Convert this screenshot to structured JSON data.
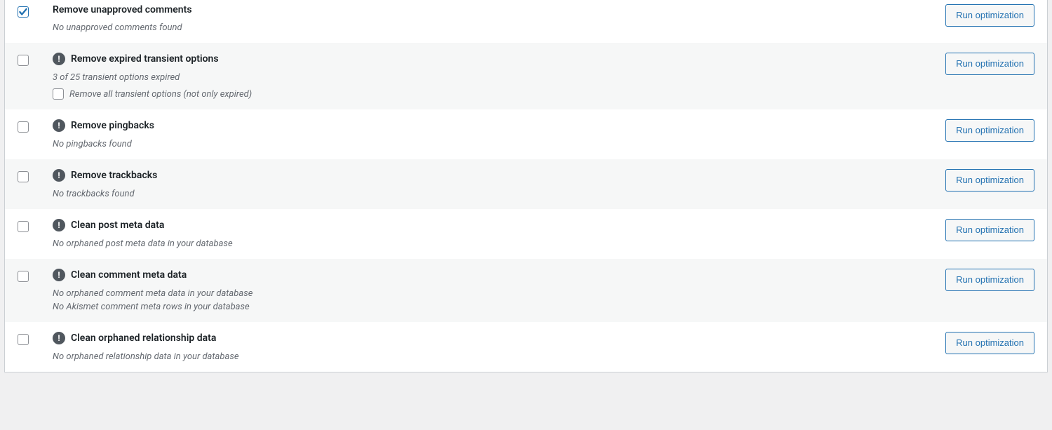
{
  "button_label": "Run optimization",
  "rows": [
    {
      "id": "unapproved-comments",
      "checked": true,
      "warn": false,
      "title": "Remove unapproved comments",
      "desc": [
        "No unapproved comments found"
      ],
      "sub_option": null,
      "alt": false
    },
    {
      "id": "expired-transients",
      "checked": false,
      "warn": true,
      "title": "Remove expired transient options",
      "desc": [
        "3 of 25 transient options expired"
      ],
      "sub_option": {
        "checked": false,
        "label": "Remove all transient options (not only expired)"
      },
      "alt": true
    },
    {
      "id": "pingbacks",
      "checked": false,
      "warn": true,
      "title": "Remove pingbacks",
      "desc": [
        "No pingbacks found"
      ],
      "sub_option": null,
      "alt": false
    },
    {
      "id": "trackbacks",
      "checked": false,
      "warn": true,
      "title": "Remove trackbacks",
      "desc": [
        "No trackbacks found"
      ],
      "sub_option": null,
      "alt": true
    },
    {
      "id": "post-meta",
      "checked": false,
      "warn": true,
      "title": "Clean post meta data",
      "desc": [
        "No orphaned post meta data in your database"
      ],
      "sub_option": null,
      "alt": false
    },
    {
      "id": "comment-meta",
      "checked": false,
      "warn": true,
      "title": "Clean comment meta data",
      "desc": [
        "No orphaned comment meta data in your database",
        "No Akismet comment meta rows in your database"
      ],
      "sub_option": null,
      "alt": true
    },
    {
      "id": "relationship",
      "checked": false,
      "warn": true,
      "title": "Clean orphaned relationship data",
      "desc": [
        "No orphaned relationship data in your database"
      ],
      "sub_option": null,
      "alt": false
    }
  ]
}
